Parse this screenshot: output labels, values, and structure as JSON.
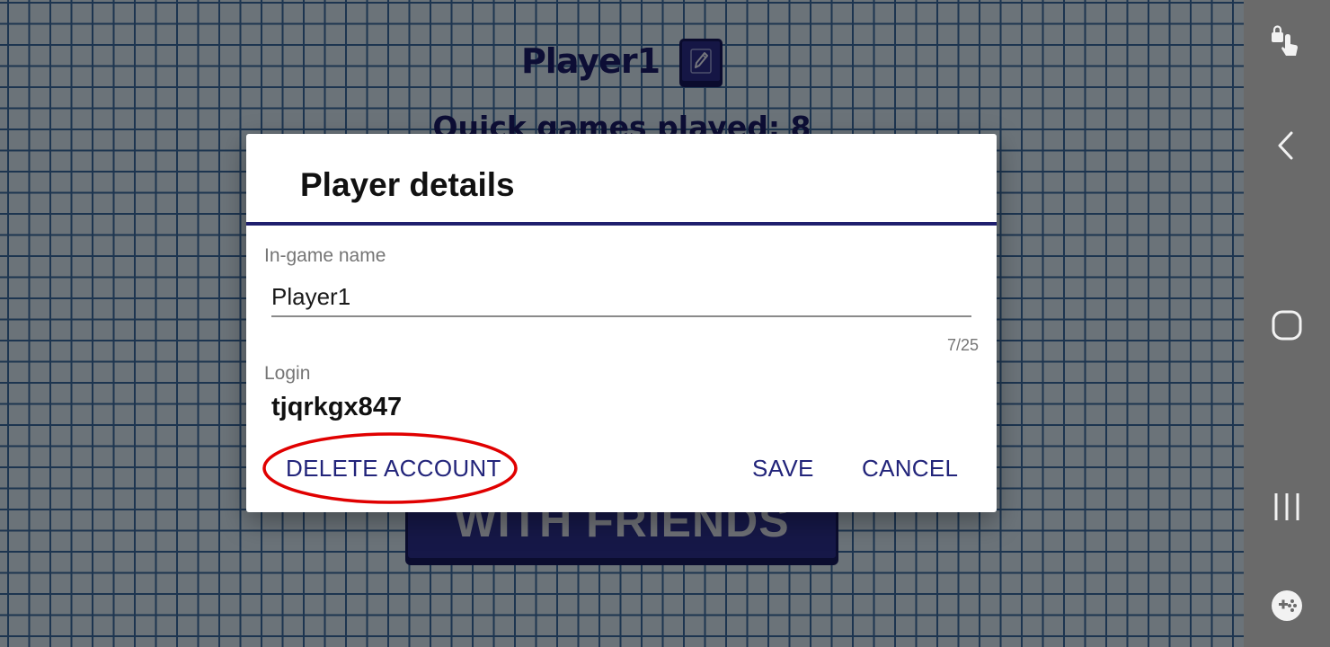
{
  "background": {
    "player_name": "Player1",
    "games_played": "Quick games played: 8",
    "friends_button_label": "WITH FRIENDS"
  },
  "dialog": {
    "title": "Player details",
    "name_label": "In-game name",
    "name_value": "Player1",
    "char_counter": "7/25",
    "login_label": "Login",
    "login_value": "tjqrkgx847",
    "delete_label": "DELETE ACCOUNT",
    "save_label": "SAVE",
    "cancel_label": "CANCEL"
  },
  "nav": {
    "icons": [
      "lock-touch-icon",
      "back-icon",
      "home-icon",
      "recents-icon",
      "game-tools-icon"
    ]
  },
  "colors": {
    "accent": "#22247a",
    "highlight": "#e00000",
    "divider": "#1f1f6e"
  }
}
